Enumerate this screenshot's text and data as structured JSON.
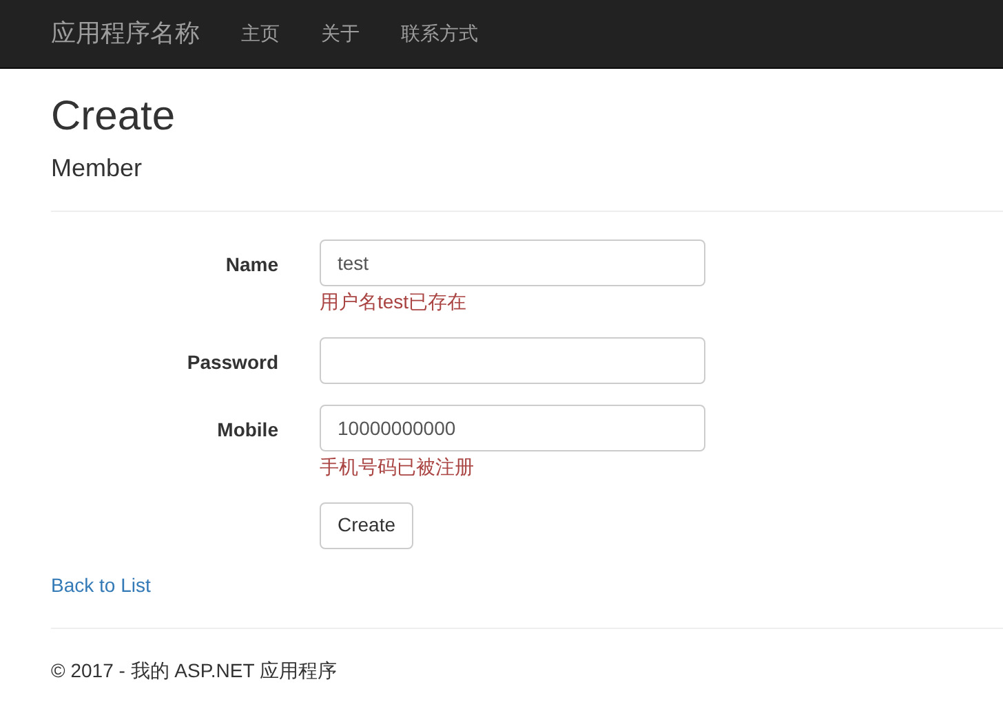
{
  "navbar": {
    "brand": "应用程序名称",
    "links": [
      "主页",
      "关于",
      "联系方式"
    ]
  },
  "title": "Create",
  "subtitle": "Member",
  "form": {
    "fields": [
      {
        "label": "Name",
        "value": "test",
        "error": "用户名test已存在"
      },
      {
        "label": "Password"
      },
      {
        "label": "Mobile",
        "value": "10000000000",
        "error": "手机号码已被注册"
      }
    ],
    "submit": "Create"
  },
  "back_link": "Back to List",
  "footer": "© 2017 - 我的 ASP.NET 应用程序"
}
